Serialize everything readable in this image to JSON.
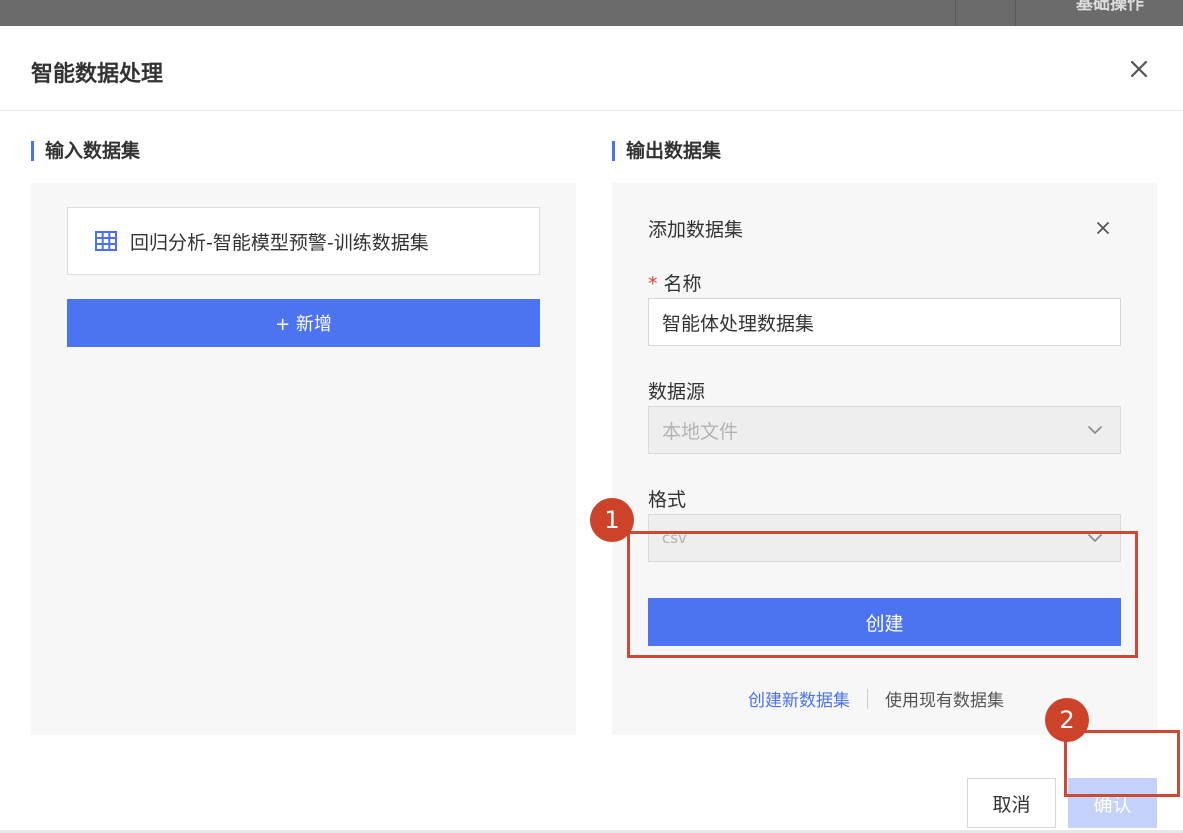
{
  "background": {
    "strip_text": "基础操作"
  },
  "dialog": {
    "title": "智能数据处理",
    "close_icon": "close-icon"
  },
  "input_section": {
    "title": "输入数据集",
    "items": [
      {
        "label": "回归分析-智能模型预警-训练数据集",
        "icon": "table-grid-icon"
      }
    ],
    "add_button_label": "+ 新增"
  },
  "output_section": {
    "title": "输出数据集",
    "add_panel": {
      "title": "添加数据集",
      "close_icon": "close-icon",
      "name_required_mark": "*",
      "name_label": "名称",
      "name_value": "智能体处理数据集",
      "source_label": "数据源",
      "source_value": "本地文件",
      "format_label": "格式",
      "format_value": "csv",
      "create_button_label": "创建"
    },
    "link_new": "创建新数据集",
    "link_existing": "使用现有数据集"
  },
  "footer": {
    "cancel_label": "取消",
    "confirm_label": "确认"
  },
  "annotations": {
    "badge_1": "1",
    "badge_2": "2"
  },
  "colors": {
    "accent": "#4c73f0",
    "accent_disabled": "#c4d2fb",
    "annotation": "#cc4329",
    "required": "#e0422d"
  }
}
